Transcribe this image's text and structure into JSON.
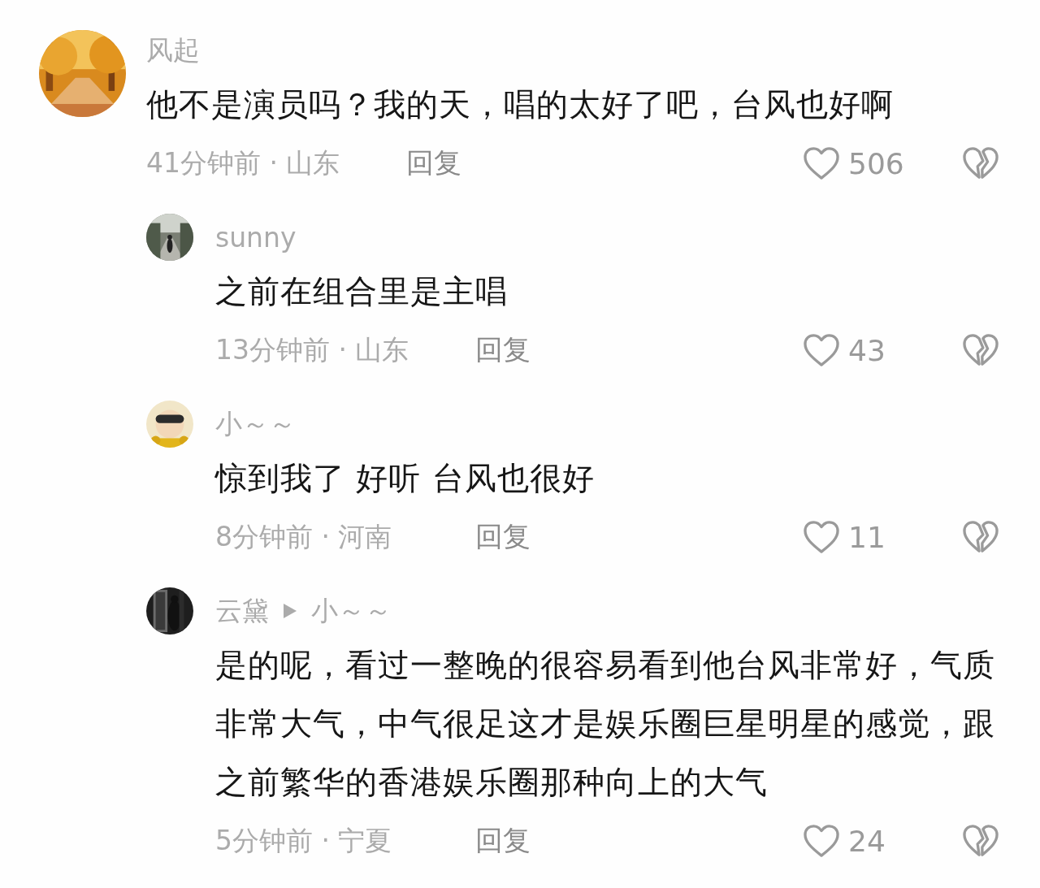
{
  "comments": [
    {
      "author": "风起",
      "text": "他不是演员吗？我的天，唱的太好了吧，台风也好啊",
      "time": "41分钟前 · 山东",
      "reply_label": "回复",
      "likes": "506",
      "replies": [
        {
          "author": "sunny",
          "text": "之前在组合里是主唱",
          "time": "13分钟前 · 山东",
          "reply_label": "回复",
          "likes": "43"
        },
        {
          "author": "小～～",
          "text": "惊到我了  好听  台风也很好",
          "time": "8分钟前 · 河南",
          "reply_label": "回复",
          "likes": "11"
        },
        {
          "author": "云黛",
          "reply_to": "小～～",
          "text": "是的呢，看过一整晚的很容易看到他台风非常好，气质非常大气，中气很足这才是娱乐圈巨星明星的感觉，跟之前繁华的香港娱乐圈那种向上的大气",
          "time": "5分钟前 · 宁夏",
          "reply_label": "回复",
          "likes": "24"
        }
      ]
    }
  ]
}
